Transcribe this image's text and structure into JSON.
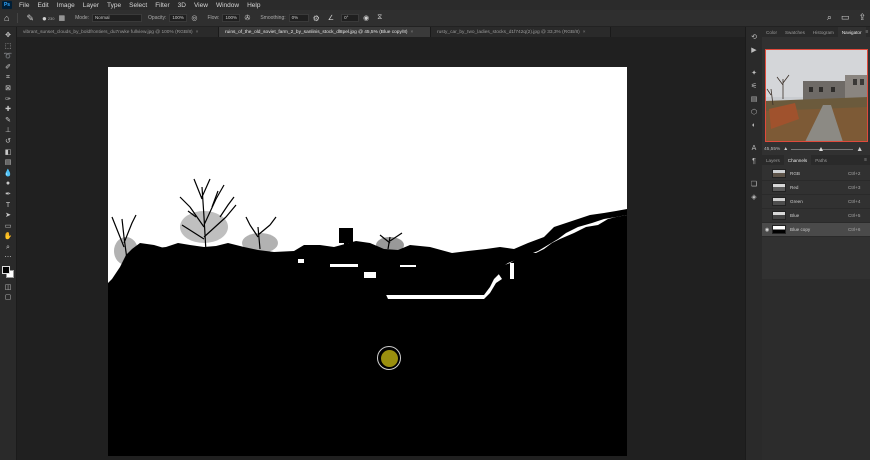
{
  "app": {
    "logo": "Ps"
  },
  "menu": [
    "File",
    "Edit",
    "Image",
    "Layer",
    "Type",
    "Select",
    "Filter",
    "3D",
    "View",
    "Window",
    "Help"
  ],
  "options_bar": {
    "brush_size": "230",
    "mode_label": "Mode:",
    "mode_value": "Normal",
    "opacity_label": "Opacity:",
    "opacity_value": "100%",
    "flow_label": "Flow:",
    "flow_value": "100%",
    "smoothing_label": "Smoothing:",
    "smoothing_value": "0%",
    "angle_value": "0°",
    "right_icons": [
      "search-icon",
      "workspace-icon",
      "share-icon"
    ]
  },
  "document_tabs": [
    {
      "label": "vibrant_sunset_clouds_by_boldfrontiers_du7nwke fullview.jpg @ 100% (RGB/8)",
      "active": false
    },
    {
      "label": "ruins_of_the_old_soviet_farm_2_by_sanlinis_stock_dl8pel.jpg @ 45,5% (Blue copy/8)",
      "active": true
    },
    {
      "label": "rusty_car_by_two_ladies_stocks_d1f742q(2).jpg @ 33,3% (RGB/8)",
      "active": false
    }
  ],
  "tab_close_glyph": "×",
  "tools": [
    "move-icon",
    "marquee-icon",
    "lasso-icon",
    "quick-select-icon",
    "crop-icon",
    "frame-icon",
    "eyedropper-icon",
    "healing-icon",
    "brush-icon",
    "clone-stamp-icon",
    "history-brush-icon",
    "eraser-icon",
    "gradient-icon",
    "blur-icon",
    "dodge-icon",
    "pen-icon",
    "type-icon",
    "path-select-icon",
    "rectangle-icon",
    "hand-icon",
    "zoom-icon",
    "more-tools-icon"
  ],
  "colors": {
    "foreground": "#000000",
    "background": "#ffffff",
    "brush_cursor": "#9a8f0e",
    "navigator_frame": "#e04a3c"
  },
  "top_panel_tabs": [
    {
      "label": "Color",
      "active": false
    },
    {
      "label": "Swatches",
      "active": false
    },
    {
      "label": "Histogram",
      "active": false
    },
    {
      "label": "Navigator",
      "active": true
    }
  ],
  "navigator": {
    "zoom": "45,55%"
  },
  "bottom_panel_tabs": [
    {
      "label": "Layers",
      "active": false
    },
    {
      "label": "Channels",
      "active": true
    },
    {
      "label": "Paths",
      "active": false
    }
  ],
  "panel_menu_glyph": "≡",
  "channels": [
    {
      "name": "RGB",
      "shortcut": "Ctrl+2",
      "selected": false,
      "visible": false
    },
    {
      "name": "Red",
      "shortcut": "Ctrl+3",
      "selected": false,
      "visible": false
    },
    {
      "name": "Green",
      "shortcut": "Ctrl+4",
      "selected": false,
      "visible": false
    },
    {
      "name": "Blue",
      "shortcut": "Ctrl+5",
      "selected": false,
      "visible": false
    },
    {
      "name": "Blue copy",
      "shortcut": "Ctrl+6",
      "selected": true,
      "visible": true
    }
  ]
}
